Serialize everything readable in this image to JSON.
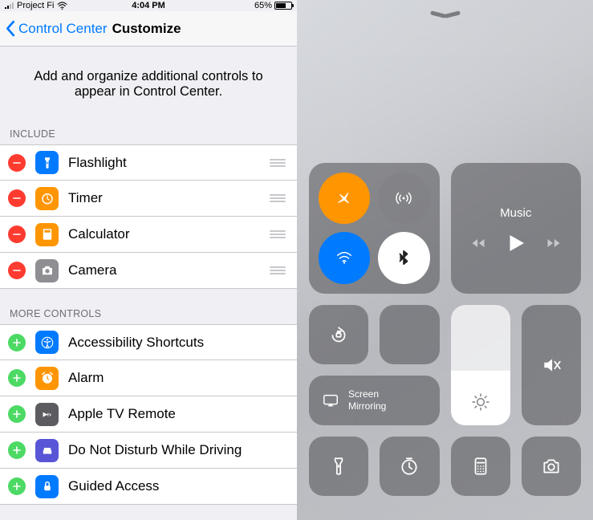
{
  "statusbar": {
    "carrier": "Project Fi",
    "time": "4:04 PM",
    "battery": "65%"
  },
  "nav": {
    "back": "Control Center",
    "title": "Customize"
  },
  "instruction": "Add and organize additional controls to appear in Control Center.",
  "include_header": "INCLUDE",
  "include": [
    {
      "label": "Flashlight",
      "icon": "flashlight",
      "color": "blue"
    },
    {
      "label": "Timer",
      "icon": "timer",
      "color": "orange"
    },
    {
      "label": "Calculator",
      "icon": "calculator",
      "color": "orange"
    },
    {
      "label": "Camera",
      "icon": "camera",
      "color": "gray"
    }
  ],
  "more_header": "MORE CONTROLS",
  "more": [
    {
      "label": "Accessibility Shortcuts",
      "icon": "accessibility",
      "color": "blue"
    },
    {
      "label": "Alarm",
      "icon": "alarm",
      "color": "orange"
    },
    {
      "label": "Apple TV Remote",
      "icon": "appletv",
      "color": "darkgray"
    },
    {
      "label": "Do Not Disturb While Driving",
      "icon": "car",
      "color": "purple"
    },
    {
      "label": "Guided Access",
      "icon": "lock",
      "color": "blue"
    }
  ],
  "cc": {
    "music_label": "Music",
    "screen_mirror": "Screen\nMirroring"
  }
}
